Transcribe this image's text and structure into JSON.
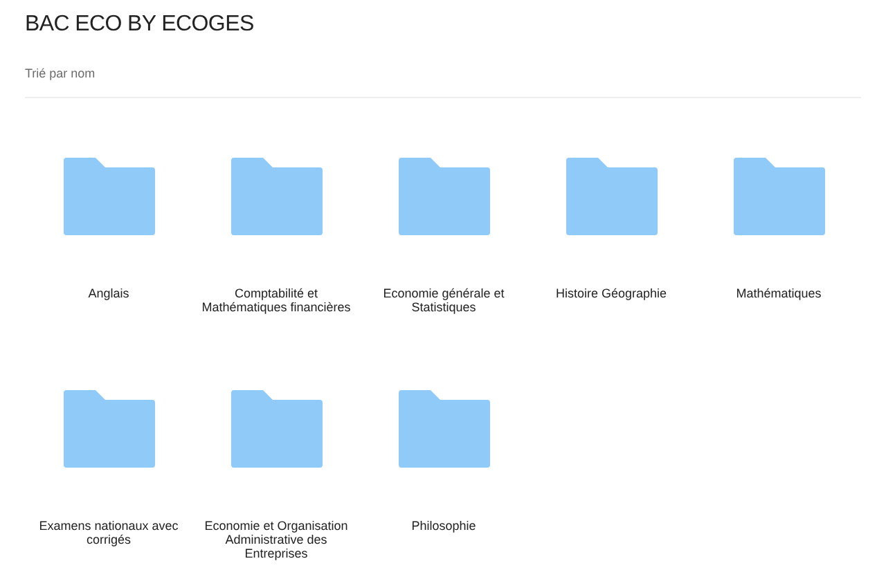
{
  "title": "BAC ECO BY ECOGES",
  "sort_label": "Trié par nom",
  "folders": [
    {
      "name": "Anglais"
    },
    {
      "name": "Comptabilité et Mathématiques financières"
    },
    {
      "name": "Economie générale et Statistiques"
    },
    {
      "name": "Histoire Géographie"
    },
    {
      "name": "Mathématiques"
    },
    {
      "name": "Examens nationaux avec corrigés"
    },
    {
      "name": "Economie et Organisation Administrative des Entreprises"
    },
    {
      "name": "Philosophie"
    }
  ]
}
